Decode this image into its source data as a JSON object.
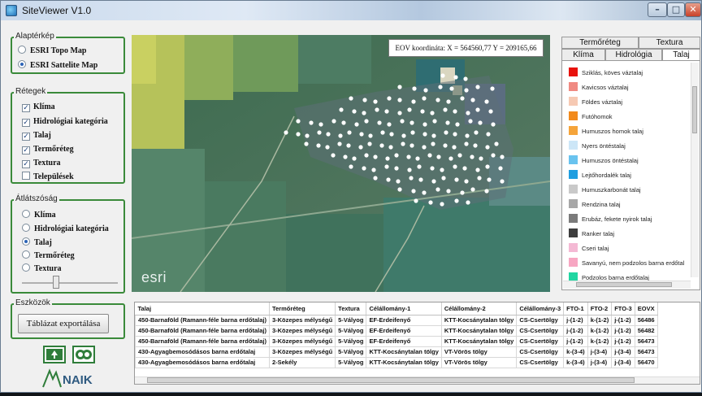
{
  "window": {
    "title": "SiteViewer V1.0"
  },
  "basemap": {
    "legend": "Alaptérkép",
    "options": [
      {
        "label": "ESRI Topo Map",
        "selected": false
      },
      {
        "label": "ESRI Sattelite Map",
        "selected": true
      }
    ]
  },
  "layers": {
    "legend": "Rétegek",
    "items": [
      {
        "label": "Klíma",
        "checked": true
      },
      {
        "label": "Hidrológiai kategória",
        "checked": true
      },
      {
        "label": "Talaj",
        "checked": true
      },
      {
        "label": "Termőréteg",
        "checked": true
      },
      {
        "label": "Textura",
        "checked": true
      },
      {
        "label": "Települések",
        "checked": false
      }
    ]
  },
  "transparency": {
    "legend": "Átlátszóság",
    "options": [
      {
        "label": "Klíma",
        "selected": false
      },
      {
        "label": "Hidrológiai kategória",
        "selected": false
      },
      {
        "label": "Talaj",
        "selected": true
      },
      {
        "label": "Termőréteg",
        "selected": false
      },
      {
        "label": "Textura",
        "selected": false
      }
    ],
    "slider_level": 0.45
  },
  "tools": {
    "legend": "Eszközök",
    "export_label": "Táblázat exportálása"
  },
  "logos": {
    "naik": "NAIK"
  },
  "map": {
    "coord_text": "EOV koordináta: X = 564560,77  Y = 209165,66",
    "esri_logo": "esri"
  },
  "legend_tabs": {
    "row1": [
      "Termőréteg",
      "Textura"
    ],
    "row2": [
      "Klíma",
      "Hidrológia",
      "Talaj"
    ],
    "active": "Talaj"
  },
  "legend_items": [
    {
      "label": "Sziklás, köves váztalaj",
      "color": "#e8120c"
    },
    {
      "label": "Kavicsos váztalaj",
      "color": "#f08a82"
    },
    {
      "label": "Földes váztalaj",
      "color": "#f6c9b3"
    },
    {
      "label": "Futóhomok",
      "color": "#f28a1c"
    },
    {
      "label": "Humuszos homok talaj",
      "color": "#f5a43a"
    },
    {
      "label": "Nyers öntéstalaj",
      "color": "#cce6f7"
    },
    {
      "label": "Humuszos öntéstalaj",
      "color": "#69c3ef"
    },
    {
      "label": "Lejtőhordalék talaj",
      "color": "#1f9ee0"
    },
    {
      "label": "Humuszkarbonát talaj",
      "color": "#c9c9c9"
    },
    {
      "label": "Rendzina talaj",
      "color": "#a7a7a7"
    },
    {
      "label": "Erubáz, fekete nyirok talaj",
      "color": "#7b7b7b"
    },
    {
      "label": "Ranker talaj",
      "color": "#3d3d3d"
    },
    {
      "label": "Cseri talaj",
      "color": "#f4b9d4"
    },
    {
      "label": "Savanyú, nem podzolos barna erdőtal",
      "color": "#f7a6c2"
    },
    {
      "label": "Podzolos barna erdőtalaj",
      "color": "#21d6a2"
    }
  ],
  "table": {
    "columns": [
      "Talaj",
      "Termőréteg",
      "Textura",
      "Célállomány-1",
      "Célállomány-2",
      "Célállomány-3",
      "FTO-1",
      "FTO-2",
      "FTO-3",
      "EOVX"
    ],
    "rows": [
      [
        "450-Barnaföld (Ramann-féle barna erdőtalaj)",
        "3-Közepes mélységű",
        "5-Vályog",
        "EF-Erdeifenyő",
        "KTT-Kocsánytalan tölgy",
        "CS-Csertölgy",
        "j-(1-2)",
        "k-(1-2)",
        "j-(1-2)",
        "56486"
      ],
      [
        "450-Barnaföld (Ramann-féle barna erdőtalaj)",
        "3-Közepes mélységű",
        "5-Vályog",
        "EF-Erdeifenyő",
        "KTT-Kocsánytalan tölgy",
        "CS-Csertölgy",
        "j-(1-2)",
        "k-(1-2)",
        "j-(1-2)",
        "56482"
      ],
      [
        "450-Barnaföld (Ramann-féle barna erdőtalaj)",
        "3-Közepes mélységű",
        "5-Vályog",
        "EF-Erdeifenyő",
        "KTT-Kocsánytalan tölgy",
        "CS-Csertölgy",
        "j-(1-2)",
        "k-(1-2)",
        "j-(1-2)",
        "56473"
      ],
      [
        "430-Agyagbemosódásos barna erdőtalaj",
        "3-Közepes mélységű",
        "5-Vályog",
        "KTT-Kocsánytalan tölgy",
        "VT-Vörös tölgy",
        "CS-Csertölgy",
        "k-(3-4)",
        "j-(3-4)",
        "j-(3-4)",
        "56473"
      ],
      [
        "430-Agyagbemosódásos barna erdőtalaj",
        "2-Sekély",
        "5-Vályog",
        "KTT-Kocsánytalan tölgy",
        "VT-Vörös tölgy",
        "CS-Csertölgy",
        "k-(3-4)",
        "j-(3-4)",
        "j-(3-4)",
        "56470"
      ]
    ]
  }
}
